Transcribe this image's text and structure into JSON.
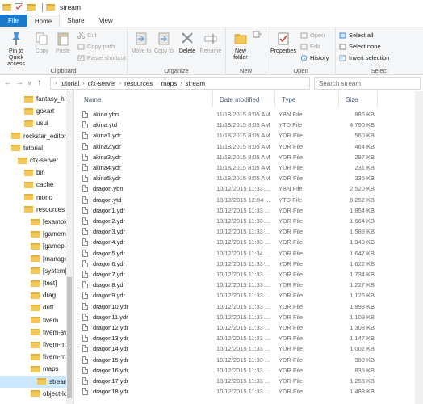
{
  "window": {
    "title": "stream"
  },
  "tabs": [
    "File",
    "Home",
    "Share",
    "View"
  ],
  "ribbon": {
    "clipboard": {
      "label": "Clipboard",
      "pin": "Pin to Quick access",
      "copy": "Copy",
      "paste": "Paste",
      "cut": "Cut",
      "copy_path": "Copy path",
      "paste_shortcut": "Paste shortcut"
    },
    "organize": {
      "label": "Organize",
      "move_to": "Move to",
      "copy_to": "Copy to",
      "delete": "Delete",
      "rename": "Rename"
    },
    "new": {
      "label": "New",
      "new_folder": "New folder"
    },
    "open": {
      "label": "Open",
      "properties": "Properties",
      "open": "Open",
      "edit": "Edit",
      "history": "History"
    },
    "select": {
      "label": "Select",
      "select_all": "Select all",
      "select_none": "Select none",
      "invert": "Invert selection"
    }
  },
  "address": {
    "breadcrumbs": [
      "tutorial",
      "cfx-server",
      "resources",
      "maps",
      "stream"
    ],
    "search_placeholder": "Search stream"
  },
  "nav": [
    {
      "label": "fantasy_hill",
      "indent": 30
    },
    {
      "label": "gokart",
      "indent": 30
    },
    {
      "label": "usui",
      "indent": 30
    },
    {
      "label": "rockstar_editor",
      "indent": 14
    },
    {
      "label": "tutorial",
      "indent": 14
    },
    {
      "label": "cfx-server",
      "indent": 22
    },
    {
      "label": "bin",
      "indent": 30
    },
    {
      "label": "cache",
      "indent": 30
    },
    {
      "label": "mono",
      "indent": 30
    },
    {
      "label": "resources",
      "indent": 30
    },
    {
      "label": "[examples]",
      "indent": 38
    },
    {
      "label": "[gamemod",
      "indent": 38
    },
    {
      "label": "[gameplay]",
      "indent": 38
    },
    {
      "label": "[managers]",
      "indent": 38
    },
    {
      "label": "[system]",
      "indent": 38
    },
    {
      "label": "[test]",
      "indent": 38
    },
    {
      "label": "drag",
      "indent": 38
    },
    {
      "label": "drift",
      "indent": 38
    },
    {
      "label": "fivem",
      "indent": 38
    },
    {
      "label": "fivem-awes",
      "indent": 38
    },
    {
      "label": "fivem-map",
      "indent": 38
    },
    {
      "label": "fivem-map",
      "indent": 38
    },
    {
      "label": "maps",
      "indent": 38
    },
    {
      "label": "stream",
      "indent": 46,
      "selected": true
    },
    {
      "label": "object-load",
      "indent": 38
    }
  ],
  "columns": {
    "name": "Name",
    "date": "Date modified",
    "type": "Type",
    "size": "Size"
  },
  "files": [
    {
      "name": "akina.ybn",
      "date": "11/18/2015 8:05 AM",
      "type": "YBN File",
      "size": "886 KB"
    },
    {
      "name": "akina.ytd",
      "date": "11/18/2015 8:05 AM",
      "type": "YTD File",
      "size": "4,790 KB"
    },
    {
      "name": "akina1.ydr",
      "date": "11/18/2015 8:05 AM",
      "type": "YDR File",
      "size": "560 KB"
    },
    {
      "name": "akina2.ydr",
      "date": "11/18/2015 8:05 AM",
      "type": "YDR File",
      "size": "464 KB"
    },
    {
      "name": "akina3.ydr",
      "date": "11/18/2015 8:05 AM",
      "type": "YDR File",
      "size": "297 KB"
    },
    {
      "name": "akina4.ydr",
      "date": "11/18/2015 8:05 AM",
      "type": "YDR File",
      "size": "231 KB"
    },
    {
      "name": "akina5.ydr",
      "date": "11/18/2015 8:05 AM",
      "type": "YDR File",
      "size": "335 KB"
    },
    {
      "name": "dragon.ybn",
      "date": "10/12/2015 11:33 ...",
      "type": "YBN File",
      "size": "2,520 KB"
    },
    {
      "name": "dragon.ytd",
      "date": "10/13/2015 12:04 ...",
      "type": "YTD File",
      "size": "6,252 KB"
    },
    {
      "name": "dragon1.ydr",
      "date": "10/12/2015 11:33 ...",
      "type": "YDR File",
      "size": "1,854 KB"
    },
    {
      "name": "dragon2.ydr",
      "date": "10/12/2015 11:33 ...",
      "type": "YDR File",
      "size": "1,664 KB"
    },
    {
      "name": "dragon3.ydr",
      "date": "10/12/2015 11:33 ...",
      "type": "YDR File",
      "size": "1,588 KB"
    },
    {
      "name": "dragon4.ydr",
      "date": "10/12/2015 11:33 ...",
      "type": "YDR File",
      "size": "1,949 KB"
    },
    {
      "name": "dragon5.ydr",
      "date": "10/12/2015 11:34 ...",
      "type": "YDR File",
      "size": "1,647 KB"
    },
    {
      "name": "dragon6.ydr",
      "date": "10/12/2015 11:33 ...",
      "type": "YDR File",
      "size": "1,622 KB"
    },
    {
      "name": "dragon7.ydr",
      "date": "10/12/2015 11:33 ...",
      "type": "YDR File",
      "size": "1,734 KB"
    },
    {
      "name": "dragon8.ydr",
      "date": "10/12/2015 11:33 ...",
      "type": "YDR File",
      "size": "1,227 KB"
    },
    {
      "name": "dragon9.ydr",
      "date": "10/12/2015 11:33 ...",
      "type": "YDR File",
      "size": "1,126 KB"
    },
    {
      "name": "dragon10.ydr",
      "date": "10/12/2015 11:33 ...",
      "type": "YDR File",
      "size": "1,893 KB"
    },
    {
      "name": "dragon11.ydr",
      "date": "10/12/2015 11:33 ...",
      "type": "YDR File",
      "size": "1,109 KB"
    },
    {
      "name": "dragon12.ydr",
      "date": "10/12/2015 11:33 ...",
      "type": "YDR File",
      "size": "1,308 KB"
    },
    {
      "name": "dragon13.ydr",
      "date": "10/12/2015 11:33 ...",
      "type": "YDR File",
      "size": "1,147 KB"
    },
    {
      "name": "dragon14.ydr",
      "date": "10/12/2015 11:33 ...",
      "type": "YDR File",
      "size": "1,002 KB"
    },
    {
      "name": "dragon15.ydr",
      "date": "10/12/2015 11:33 ...",
      "type": "YDR File",
      "size": "900 KB"
    },
    {
      "name": "dragon16.ydr",
      "date": "10/12/2015 11:33 ...",
      "type": "YDR File",
      "size": "835 KB"
    },
    {
      "name": "dragon17.ydr",
      "date": "10/12/2015 11:33 ...",
      "type": "YDR File",
      "size": "1,253 KB"
    },
    {
      "name": "dragon18.ydr",
      "date": "10/12/2015 11:33 ...",
      "type": "YDR File",
      "size": "1,483 KB"
    }
  ],
  "colors": {
    "accent": "#1979ca",
    "selection": "#cce8ff",
    "header_text": "#4c607a"
  }
}
